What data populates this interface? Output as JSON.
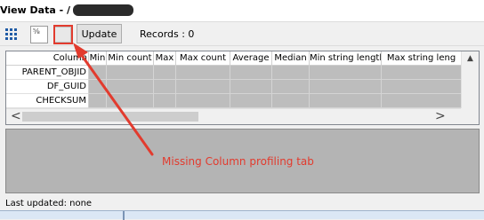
{
  "window": {
    "title": "View Data - /"
  },
  "toolbar": {
    "grid_icon": "grid-view-icon",
    "stats_icon": "column-statistics-icon",
    "stats_glyph": "⅝",
    "update_label": "Update",
    "records_text": "Records : 0"
  },
  "table": {
    "headers": [
      "Column",
      "Min",
      "Min count",
      "Max",
      "Max count",
      "Average",
      "Median",
      "Min string length",
      "Max string leng"
    ],
    "rows": [
      {
        "column": "PARENT_OBJID"
      },
      {
        "column": "DF_GUID"
      },
      {
        "column": "CHECKSUM"
      }
    ]
  },
  "scroll": {
    "up": "▲",
    "left": "<",
    "right": ">"
  },
  "annotation": {
    "text": "Missing Column profiling tab",
    "color": "#e23b2e"
  },
  "status": {
    "last_updated": "Last updated:  none"
  },
  "colors": {
    "cell_gray": "#bdbdbd",
    "accent_blue": "#1f5ba6",
    "panel_gray": "#b4b4b4"
  }
}
